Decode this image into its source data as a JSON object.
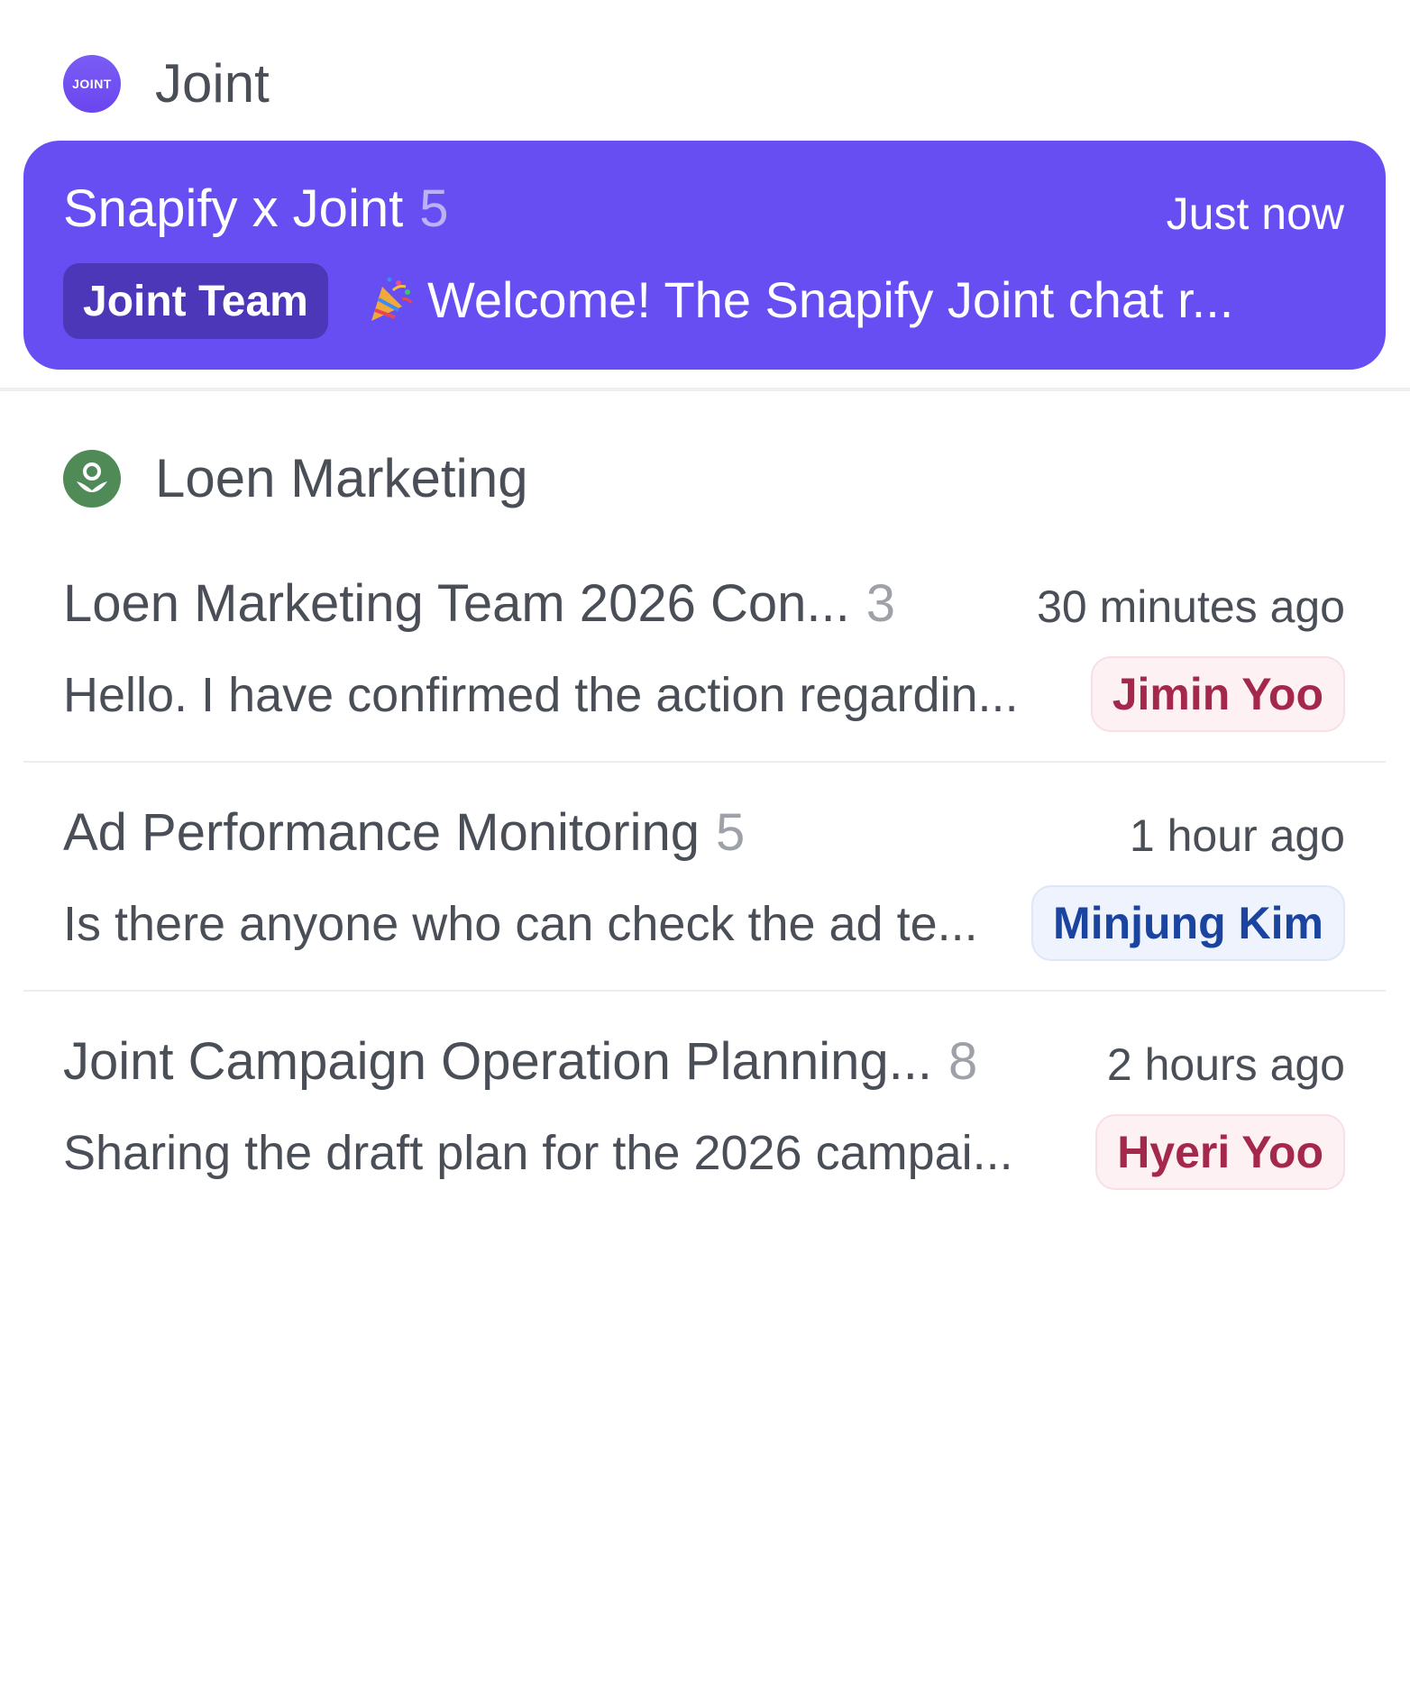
{
  "workspaces": [
    {
      "name": "Joint",
      "logo_text": "JOINT",
      "logo_color": "#6a4cf0",
      "chats": [
        {
          "title": "Snapify x Joint",
          "count": "5",
          "time": "Just now",
          "badge": "Joint Team",
          "preview": "Welcome! The Snapify Joint chat r...",
          "preview_icon": "party-popper-icon",
          "active": true
        }
      ]
    },
    {
      "name": "Loen Marketing",
      "logo_icon": "sprout-icon",
      "logo_color": "#4f8a57",
      "chats": [
        {
          "title": "Loen Marketing Team 2026 Con...",
          "count": "3",
          "time": "30 minutes ago",
          "preview": "Hello. I have confirmed the action regardin...",
          "author": "Jimin Yoo",
          "author_color": "#a3284c"
        },
        {
          "title": "Ad Performance Monitoring",
          "count": "5",
          "time": "1 hour ago",
          "preview": "Is there anyone who can check the ad te...",
          "author": "Minjung Kim",
          "author_color": "#1a44a0"
        },
        {
          "title": "Joint Campaign Operation Planning...",
          "count": "8",
          "time": "2 hours ago",
          "preview": "Sharing the draft plan for the 2026 campai...",
          "author": "Hyeri Yoo",
          "author_color": "#a3284c"
        }
      ]
    }
  ],
  "colors": {
    "active_card": "#664ef3",
    "active_badge": "#4b37b8"
  }
}
